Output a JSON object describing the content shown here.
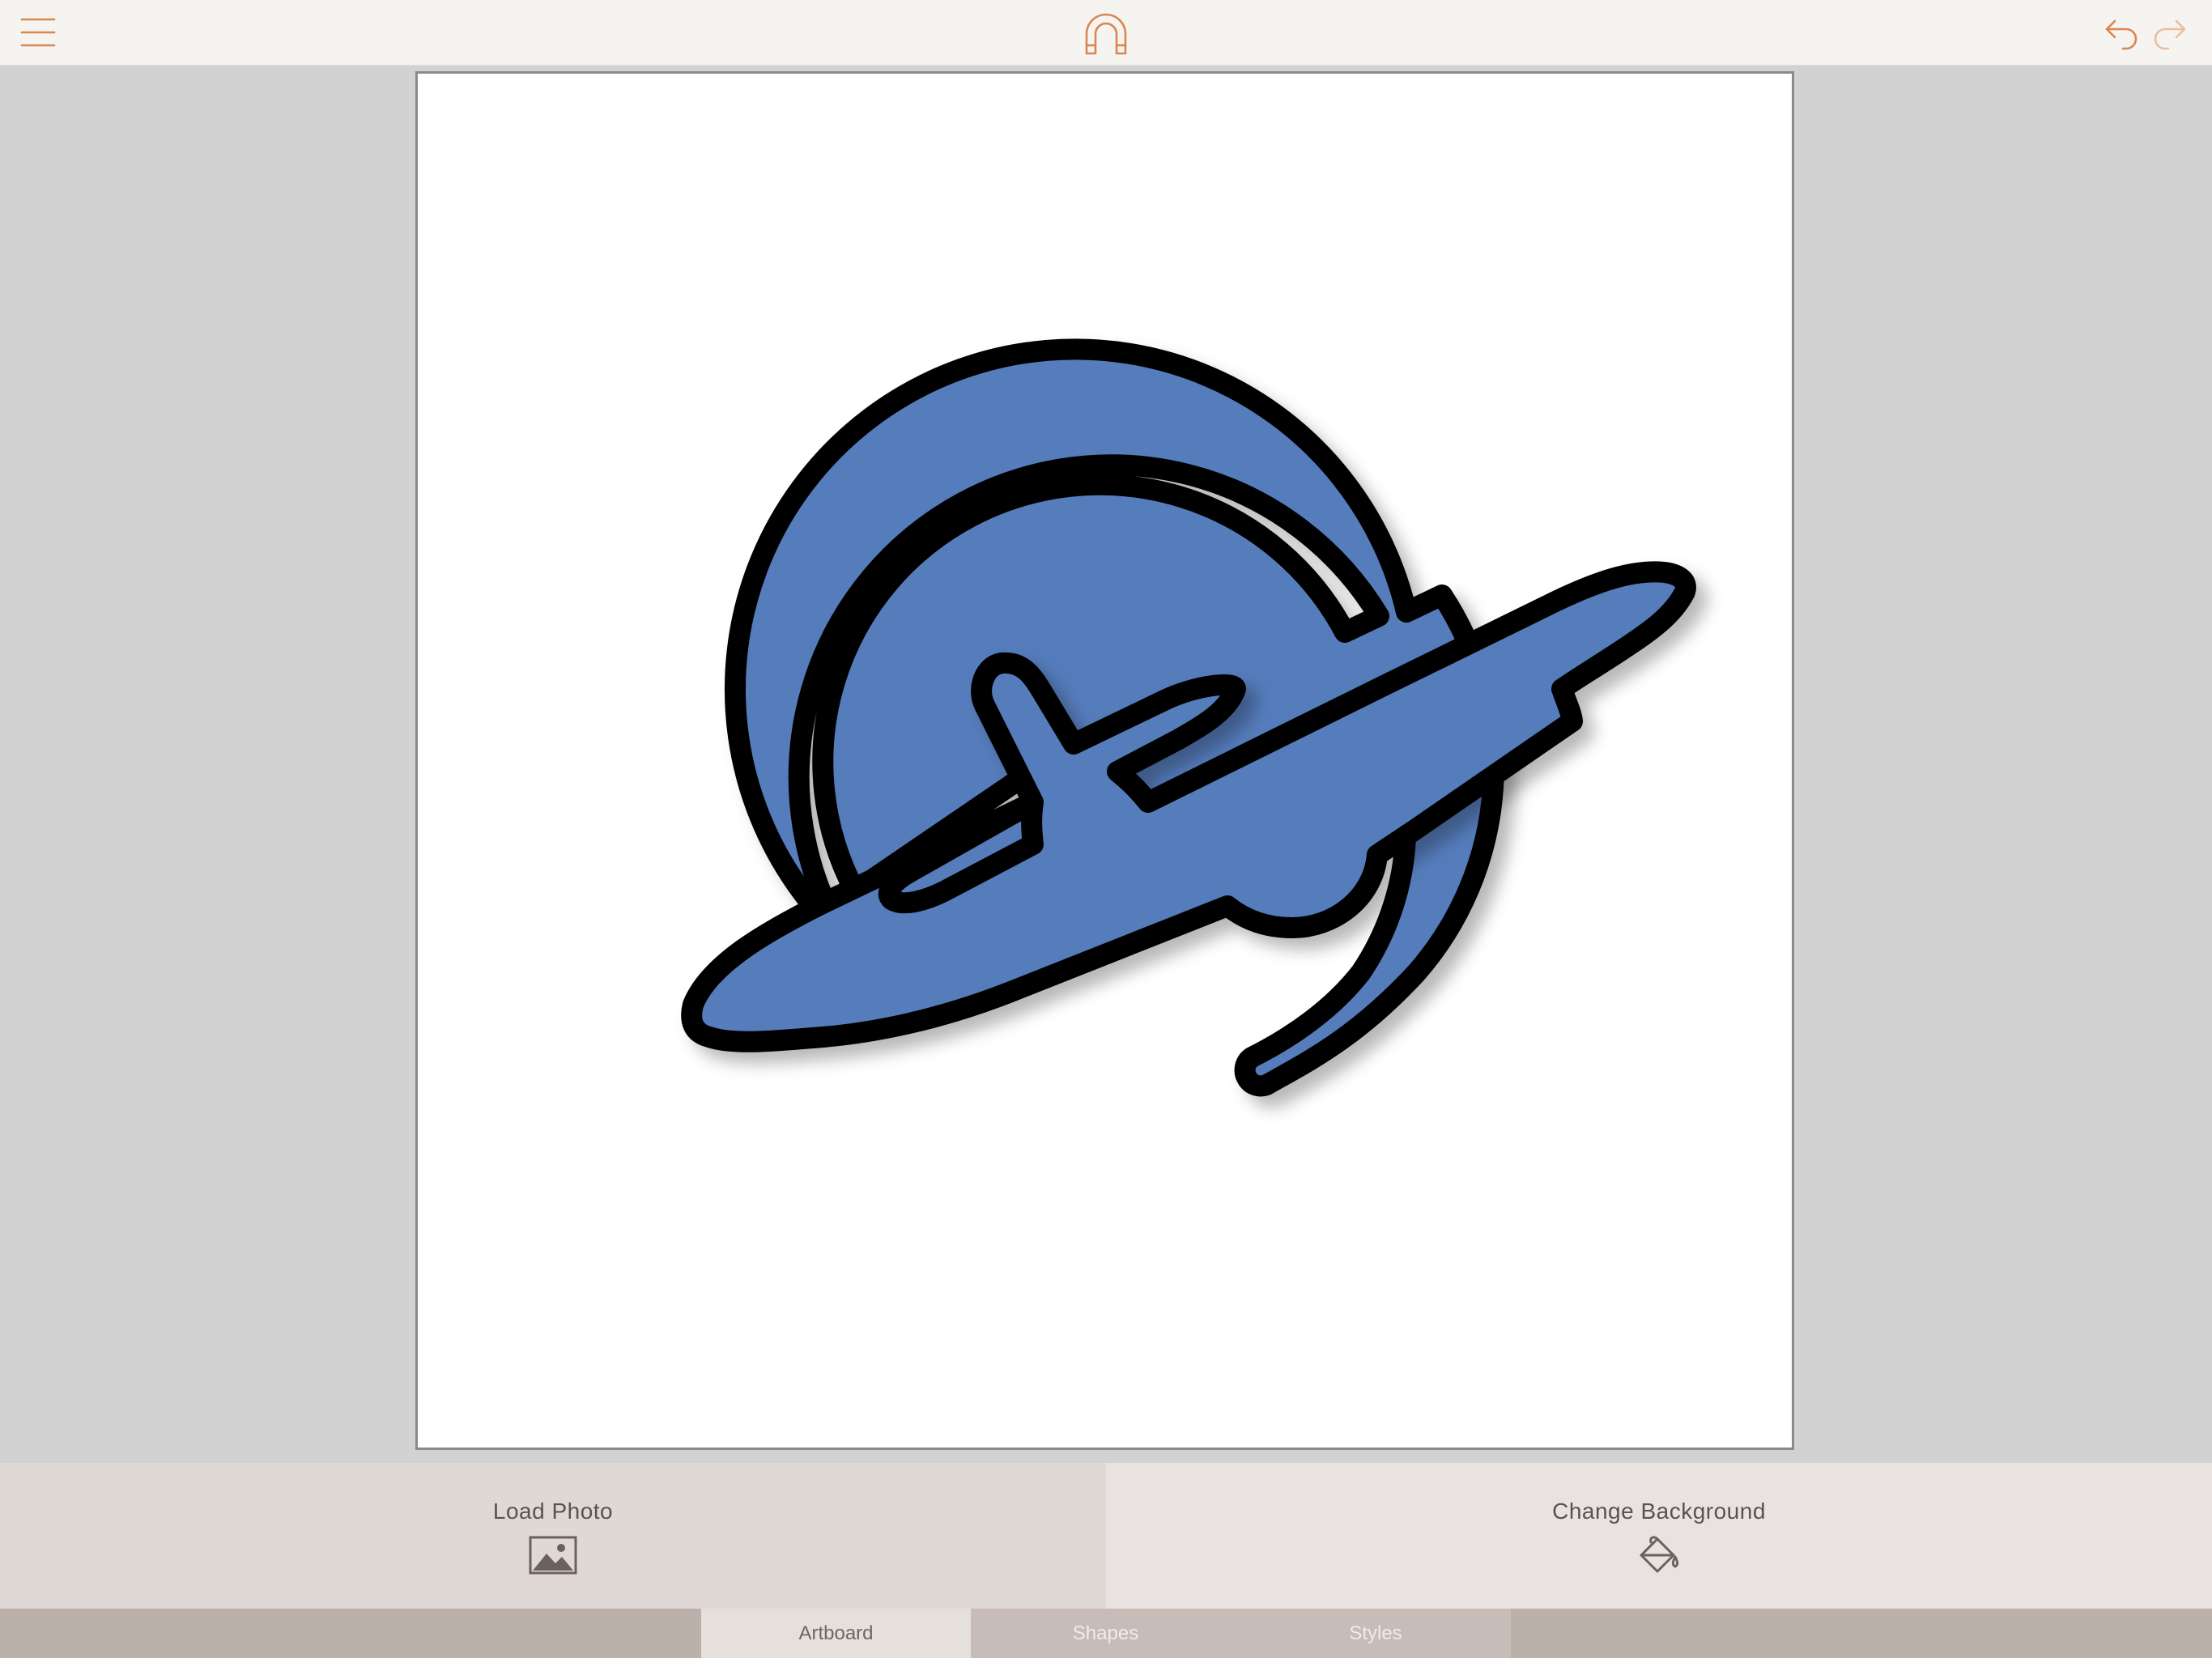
{
  "app": {
    "accent_color": "#d9864f",
    "icons": [
      "menu-icon",
      "magnet-icon",
      "undo-icon",
      "redo-icon"
    ]
  },
  "artboard": {
    "background_color": "#ffffff",
    "graphic": "airplane-orbit-logo",
    "fill_color": "#557bbb",
    "stroke_color": "#000000"
  },
  "actions": {
    "load_photo": {
      "label": "Load Photo",
      "icon": "image-icon"
    },
    "change_background": {
      "label": "Change Background",
      "icon": "paint-bucket-icon"
    }
  },
  "tabs": [
    {
      "label": "Artboard",
      "selected": true
    },
    {
      "label": "Shapes",
      "selected": false
    },
    {
      "label": "Styles",
      "selected": false
    }
  ]
}
